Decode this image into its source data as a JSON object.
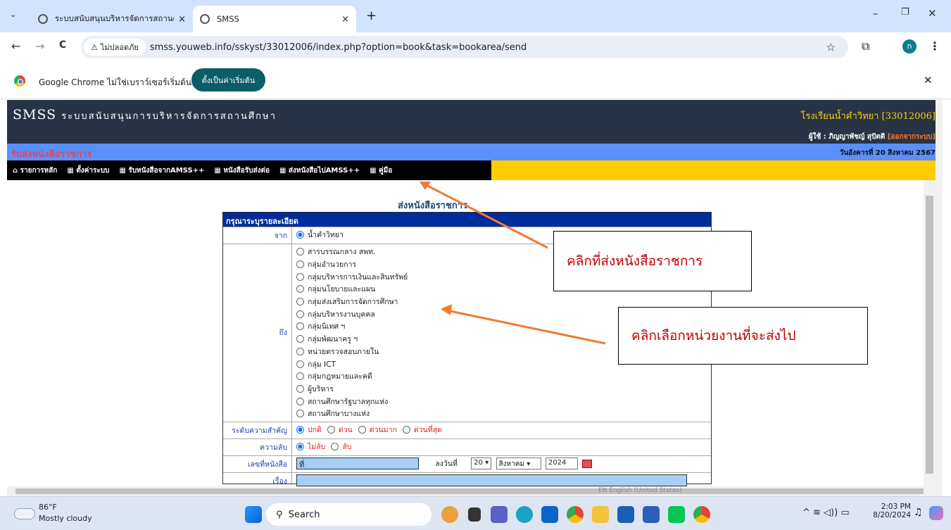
{
  "browser": {
    "tabs": [
      {
        "title": "ระบบสนับสนุนบริหารจัดการสถานศึกษ",
        "close": "×"
      },
      {
        "title": "SMSS",
        "close": "×"
      }
    ],
    "new_tab": "+",
    "window": {
      "minimize": "–",
      "restore": "❐",
      "close": "✕"
    },
    "nav": {
      "back": "←",
      "forward": "→",
      "reload": "C"
    },
    "security_label": "ไม่ปลอดภัย",
    "url": "smss.youweb.info/sskyst/33012006/index.php?option=book&task=bookarea/send",
    "profile_initial": "n",
    "infobar_text": "Google Chrome ไม่ใช่เบราว์เซอร์เริ่มต้น",
    "infobar_button": "ตั้งเป็นค่าเริ่มต้น"
  },
  "app": {
    "logo": "SMSS",
    "subtitle": "ระบบสนับสนุนการบริหารจัดการสถานศึกษา",
    "school": "โรงเรียนน้ำคำวิทยา [33012006]",
    "user": "ผู้ใช้ : ภิญญาพัชญ์ สุปัตติ",
    "logout": "[ออกจากระบบ]",
    "section": "รับส่งหนังสือราชการ",
    "date": "วันอังคารที่ 20 สิงหาคม 2567",
    "menu": [
      {
        "icon": "home-icon",
        "label": "รายการหลัก"
      },
      {
        "icon": "grid-icon",
        "label": "ตั้งค่าระบบ"
      },
      {
        "icon": "grid-icon",
        "label": "รับหนังสือจากAMSS++"
      },
      {
        "icon": "grid-icon",
        "label": "หนังสือรับส่งต่อ"
      },
      {
        "icon": "grid-icon",
        "label": "ส่งหนังสือไปAMSS++"
      },
      {
        "icon": "grid-icon",
        "label": "คู่มือ"
      }
    ]
  },
  "form": {
    "page_title": "ส่งหนังสือราชการ",
    "header": "กรุณาระบุรายละเอียด",
    "from_label": "จาก",
    "from_value": "น้ำคำวิทยา",
    "to_label": "ถึง",
    "to_options": [
      "สารบรรณกลาง สพท.",
      "กลุ่มอำนวยการ",
      "กลุ่มบริหารการเงินและสินทรัพย์",
      "กลุ่มนโยบายและแผน",
      "กลุ่มส่งเสริมการจัดการศึกษา",
      "กลุ่มบริหารงานบุคคล",
      "กลุ่มนิเทศ ฯ",
      "กลุ่มพัฒนาครู ฯ",
      "หน่วยตรวจสอบภายใน",
      "กลุ่ม ICT",
      "กลุ่มกฎหมายและคดี",
      "ผู้บริหาร",
      "สถานศึกษารัฐบาลทุกแห่ง",
      "สถานศึกษาบางแห่ง"
    ],
    "priority_label": "ระดับความสำคัญ",
    "priority_options": [
      "ปกติ",
      "ด่วน",
      "ด่วนมาก",
      "ด่วนที่สุด"
    ],
    "secret_label": "ความลับ",
    "secret_options": [
      "ไม่ลับ",
      "ลับ"
    ],
    "bookno_label": "เลขที่หนังสือ",
    "bookno_value": "ที่",
    "date_label": "ลงวันที่",
    "day": "20",
    "month": "สิงหาคม",
    "year": "2024",
    "subject_label": "เรื่อง"
  },
  "callouts": {
    "menu_hint": "คลิกที่ส่งหนังสือราชการ",
    "dest_hint": "คลิกเลือกหน่วยงานที่จะส่งไป"
  },
  "ime": "EN English (United States)",
  "taskbar": {
    "weather_temp": "86°F",
    "weather_desc": "Mostly cloudy",
    "search": "Search",
    "time": "2:03 PM",
    "date": "8/20/2024"
  },
  "colors": {
    "header_bg": "#283445",
    "menu_yellow": "#ffcc00",
    "form_header": "#002b9a",
    "callout_text": "#c00000",
    "arrow": "#ed7d31"
  }
}
